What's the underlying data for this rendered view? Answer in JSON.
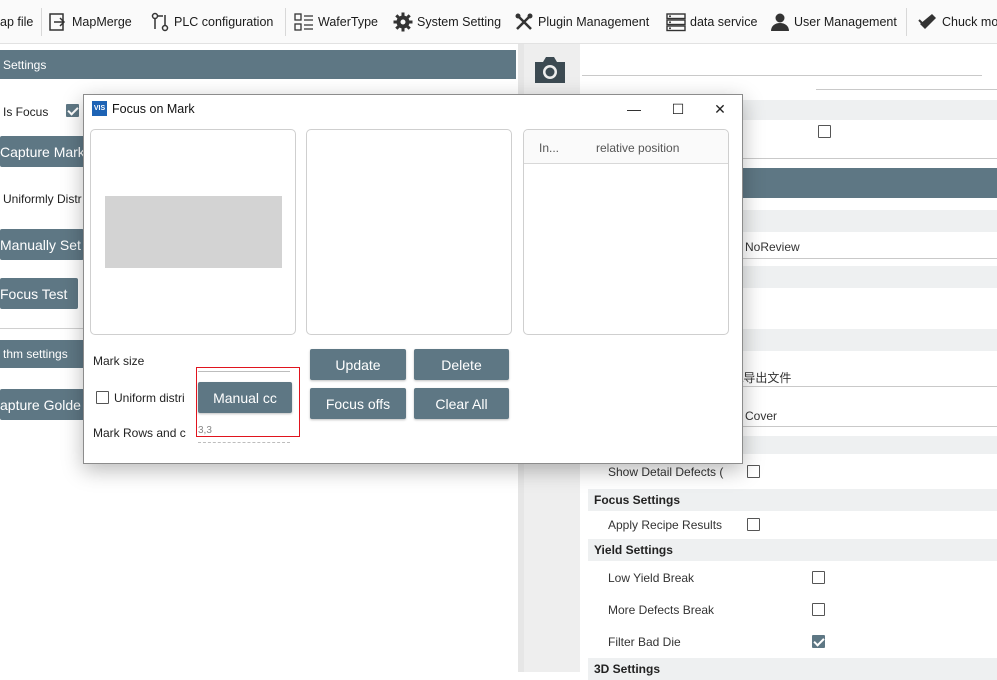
{
  "toolbar": {
    "items": [
      {
        "label": "ap file",
        "icon": "file-icon"
      },
      {
        "label": "MapMerge",
        "icon": "map-merge-icon"
      },
      {
        "label": "PLC configuration",
        "icon": "plc-icon"
      },
      {
        "label": "WaferType",
        "icon": "wafer-type-icon"
      },
      {
        "label": "System Setting",
        "icon": "gear-icon"
      },
      {
        "label": "Plugin Management",
        "icon": "tools-icon"
      },
      {
        "label": "data service",
        "icon": "server-icon"
      },
      {
        "label": "User Management",
        "icon": "user-icon"
      },
      {
        "label": "Chuck mo",
        "icon": "chuck-icon"
      }
    ]
  },
  "left": {
    "settings_header": "Settings",
    "is_focus_label": "Is Focus",
    "capture_mark": "Capture Mark",
    "uniformly_distr": "Uniformly Distr",
    "manually_set": "Manually Set",
    "focus_test": "Focus Test",
    "algorithm_settings": "thm settings",
    "capture_golden": "apture Golde"
  },
  "dialog": {
    "title": "Focus on Mark",
    "app_icon_text": "VIS",
    "minimize": "—",
    "maximize": "☐",
    "close": "✕",
    "table_col1": "In...",
    "table_col2": "relative position",
    "mark_size_label": "Mark size",
    "uniform_distri_label": "Uniform distri",
    "manual_button": "Manual cc",
    "mark_rows_label": "Mark Rows and c",
    "mark_rows_value": "3,3",
    "update_button": "Update",
    "delete_button": "Delete",
    "focus_offs_button": "Focus offs",
    "clear_all_button": "Clear All"
  },
  "right": {
    "no_review": "NoReview",
    "export_path": "\\导出文件",
    "cover": "Cover",
    "show_detail_defects": "Show Detail Defects (",
    "focus_settings": "Focus Settings",
    "apply_recipe_results": "Apply Recipe Results",
    "yield_settings": "Yield Settings",
    "low_yield_break": "Low Yield Break",
    "more_defects_break": "More Defects Break",
    "filter_bad_die": "Filter Bad Die",
    "settings_3d": "3D Settings"
  },
  "colors": {
    "accent": "#5e7784",
    "highlight": "#e0141e"
  }
}
